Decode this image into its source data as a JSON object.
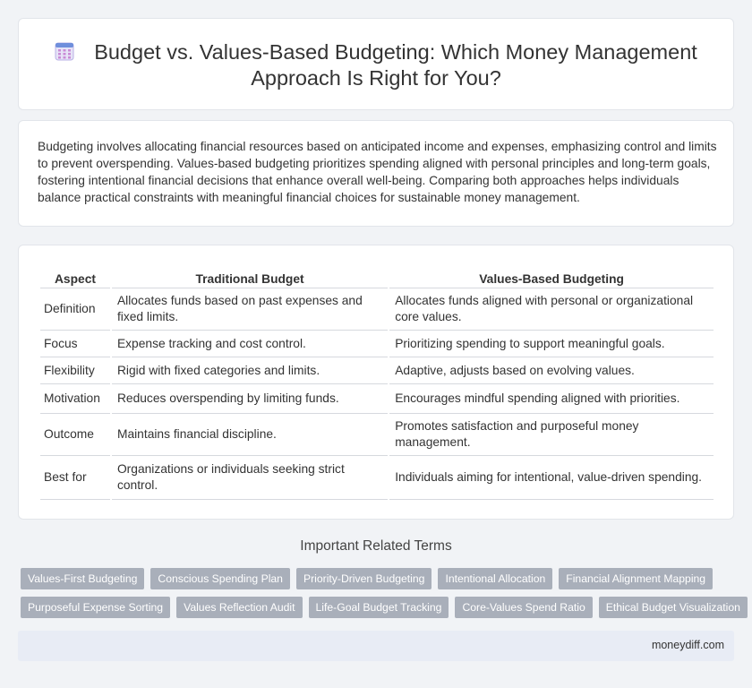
{
  "header": {
    "icon": "calendar-icon",
    "title": "Budget vs. Values-Based Budgeting: Which Money Management Approach Is Right for You?"
  },
  "intro": "Budgeting involves allocating financial resources based on anticipated income and expenses, emphasizing control and limits to prevent overspending. Values-based budgeting prioritizes spending aligned with personal principles and long-term goals, fostering intentional financial decisions that enhance overall well-being. Comparing both approaches helps individuals balance practical constraints with meaningful financial choices for sustainable money management.",
  "table": {
    "headers": [
      "Aspect",
      "Traditional Budget",
      "Values-Based Budgeting"
    ],
    "rows": [
      [
        "Definition",
        "Allocates funds based on past expenses and fixed limits.",
        "Allocates funds aligned with personal or organizational core values."
      ],
      [
        "Focus",
        "Expense tracking and cost control.",
        "Prioritizing spending to support meaningful goals."
      ],
      [
        "Flexibility",
        "Rigid with fixed categories and limits.",
        "Adaptive, adjusts based on evolving values."
      ],
      [
        "Motivation",
        "Reduces overspending by limiting funds.",
        "Encourages mindful spending aligned with priorities."
      ],
      [
        "Outcome",
        "Maintains financial discipline.",
        "Promotes satisfaction and purposeful money management."
      ],
      [
        "Best for",
        "Organizations or individuals seeking strict control.",
        "Individuals aiming for intentional, value-driven spending."
      ]
    ]
  },
  "related": {
    "title": "Important Related Terms",
    "rows": [
      [
        "Values-First Budgeting",
        "Conscious Spending Plan",
        "Priority-Driven Budgeting",
        "Intentional Allocation",
        "Financial Alignment Mapping"
      ],
      [
        "Purposeful Expense Sorting",
        "Values Reflection Audit",
        "Life-Goal Budget Tracking",
        "Core-Values Spend Ratio",
        "Ethical Budget Visualization"
      ]
    ]
  },
  "footer": {
    "site": "moneydiff.com"
  },
  "colors": {
    "tag_bg": "#a9afba",
    "footer_bg": "#e8ecf5",
    "page_bg": "#f1f3f6"
  }
}
